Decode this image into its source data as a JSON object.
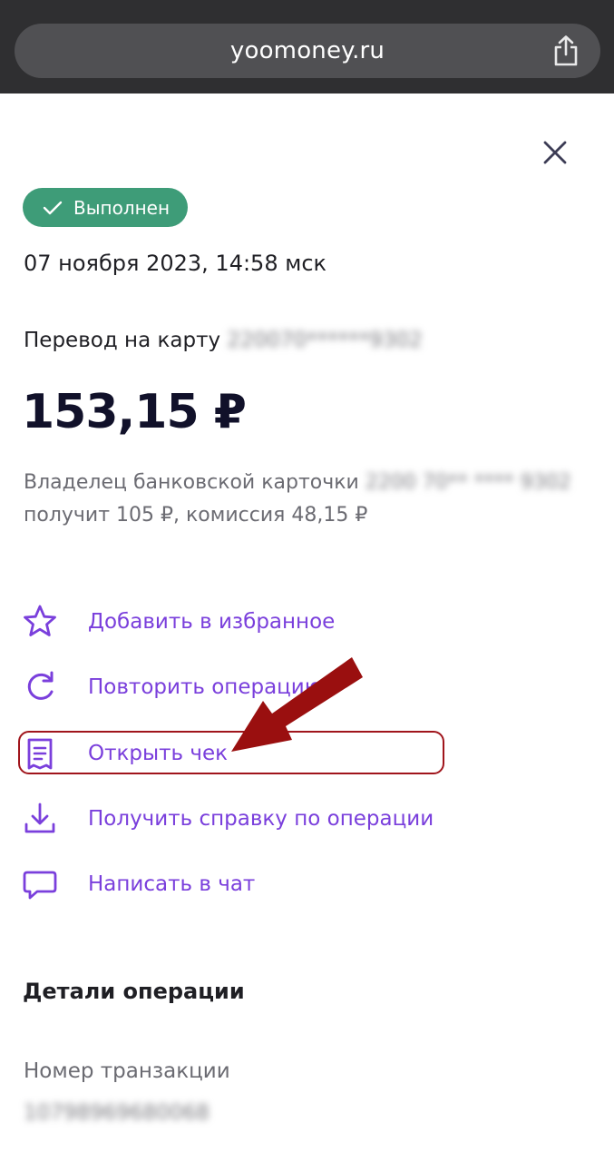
{
  "browser": {
    "url": "yoomoney.ru"
  },
  "status_badge": {
    "label": "Выполнен",
    "color": "#3e9c78"
  },
  "date": "07 ноября 2023, 14:58 мск",
  "transfer": {
    "label": "Перевод на карту",
    "card_masked": "220070******9302"
  },
  "amount": "153,15 ₽",
  "owner_text": {
    "line1_prefix": "Владелец банковской карточки",
    "card_masked": "2200 70** **** 9302",
    "line2": "получит 105 ₽, комиссия 48,15 ₽"
  },
  "actions": [
    {
      "label": "Добавить в избранное",
      "icon": "star-icon"
    },
    {
      "label": "Повторить операцию",
      "icon": "repeat-icon"
    },
    {
      "label": "Открыть чек",
      "icon": "receipt-icon"
    },
    {
      "label": "Получить справку по операции",
      "icon": "download-icon"
    },
    {
      "label": "Написать в чат",
      "icon": "chat-icon"
    }
  ],
  "details": {
    "title": "Детали операции",
    "transaction_label": "Номер транзакции",
    "transaction_value_masked": "10798969680068"
  },
  "colors": {
    "accent": "#7a3fdc",
    "annotation": "#a0151c"
  }
}
